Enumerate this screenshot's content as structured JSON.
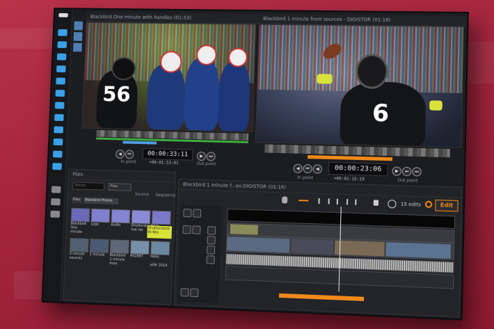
{
  "left_viewer": {
    "title": "Blackbird One minute with handles (01:53)",
    "jersey": "56",
    "timecode": "00:00:33:11",
    "offset": "+00:01:53:01",
    "in_label": "In point",
    "out_label": "Out point"
  },
  "right_viewer": {
    "title": "Blackbird 1 minute from sources - DIGISTOR (01:16)",
    "jersey": "6",
    "timecode": "00:00:23:06",
    "offset": "+00:01:15:19",
    "in_label": "In point",
    "out_label": "Out point"
  },
  "files_panel": {
    "title": "Files",
    "search_placeholder": "Search",
    "filter_label": "Files",
    "source_label": "Source",
    "sequence_label": "Sequence",
    "tabs": [
      "Files",
      "Blackbird Promo"
    ],
    "row1": [
      "Blackbird One minute",
      "Logo",
      "Audio",
      "Shutterstock low res",
      "Stills",
      "Shutterstock Hi Res"
    ],
    "row2": [
      "2 minute sources",
      "1 minute",
      "Blackbird 1 minute from",
      "4XZ887",
      "Hello",
      "atHr 2014"
    ]
  },
  "timeline": {
    "title": "Blackbird 1 minute f...es-DIGISTOR (01:16)",
    "edits_label": "15 edits",
    "edit_button": "Edit"
  },
  "colors": {
    "accent": "#f08a1a",
    "blue": "#4f9fe0",
    "green": "#3fae3f",
    "background": "#a2243c"
  }
}
